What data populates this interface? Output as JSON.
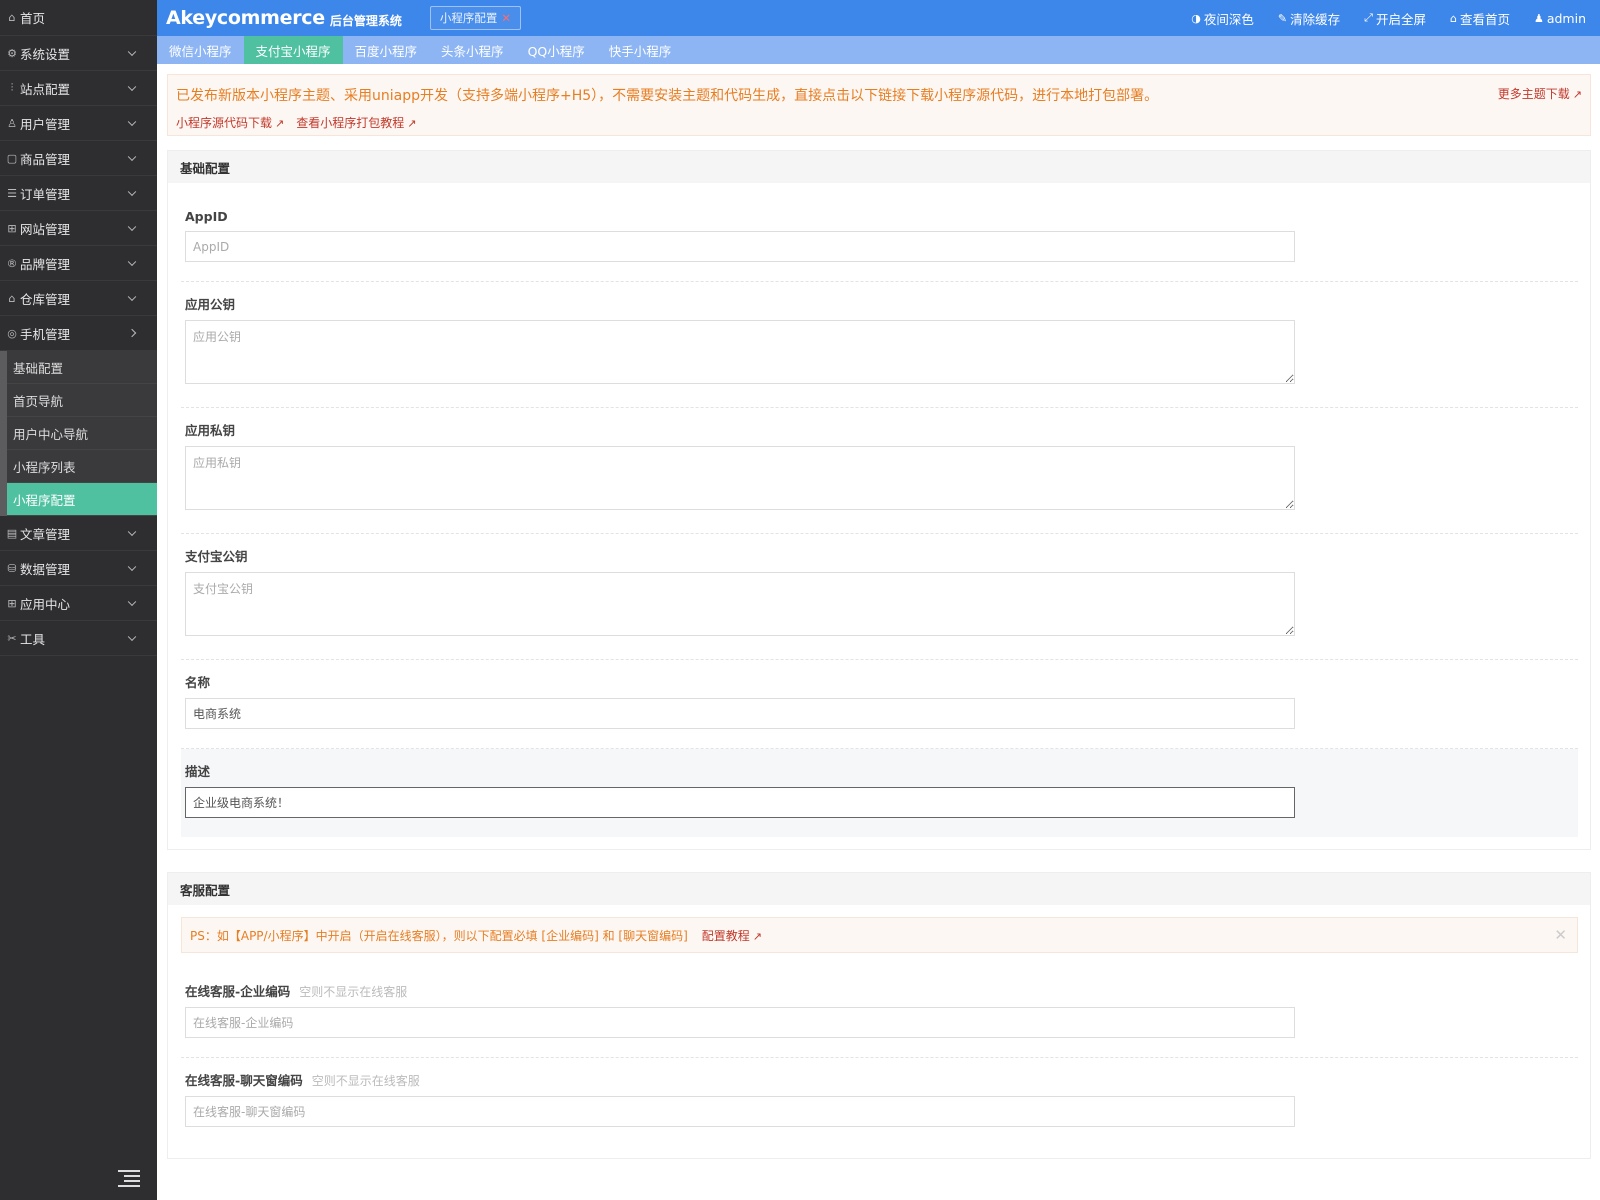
{
  "header": {
    "brand": "Akeycommerce",
    "brand_sub": "后台管理系统",
    "open_tab": "小程序配置",
    "actions": [
      {
        "icon": "contrast-icon",
        "glyph": "◑",
        "label": "夜间深色"
      },
      {
        "icon": "brush-icon",
        "glyph": "✎",
        "label": "清除缓存"
      },
      {
        "icon": "fullscreen-icon",
        "glyph": "⤢",
        "label": "开启全屏"
      },
      {
        "icon": "home-icon",
        "glyph": "⌂",
        "label": "查看首页"
      },
      {
        "icon": "user-icon",
        "glyph": "♟",
        "label": "admin"
      }
    ]
  },
  "sidebar": {
    "home": {
      "icon": "home-icon",
      "glyph": "⌂",
      "label": "首页"
    },
    "menu_top": [
      {
        "key": "system",
        "icon": "gear-icon",
        "glyph": "⚙",
        "label": "系统设置"
      },
      {
        "key": "site",
        "icon": "sliders-icon",
        "glyph": "⫶",
        "label": "站点配置"
      },
      {
        "key": "user",
        "icon": "user-icon",
        "glyph": "♙",
        "label": "用户管理"
      },
      {
        "key": "goods",
        "icon": "box-icon",
        "glyph": "▢",
        "label": "商品管理"
      },
      {
        "key": "order",
        "icon": "list-icon",
        "glyph": "☰",
        "label": "订单管理"
      },
      {
        "key": "web",
        "icon": "website-icon",
        "glyph": "⊞",
        "label": "网站管理"
      },
      {
        "key": "brand",
        "icon": "registered-icon",
        "glyph": "®",
        "label": "品牌管理"
      },
      {
        "key": "warehouse",
        "icon": "warehouse-icon",
        "glyph": "⌂",
        "label": "仓库管理"
      },
      {
        "key": "mobile",
        "icon": "mobile-icon",
        "glyph": "◎",
        "label": "手机管理"
      }
    ],
    "sub_items": [
      "基础配置",
      "首页导航",
      "用户中心导航",
      "小程序列表",
      "小程序配置"
    ],
    "menu_bottom": [
      {
        "key": "article",
        "icon": "article-icon",
        "glyph": "▤",
        "label": "文章管理"
      },
      {
        "key": "data",
        "icon": "database-icon",
        "glyph": "⛁",
        "label": "数据管理"
      },
      {
        "key": "apps",
        "icon": "apps-icon",
        "glyph": "⊞",
        "label": "应用中心"
      },
      {
        "key": "tools",
        "icon": "tools-icon",
        "glyph": "✂",
        "label": "工具"
      }
    ]
  },
  "subtabs": [
    "微信小程序",
    "支付宝小程序",
    "百度小程序",
    "头条小程序",
    "QQ小程序",
    "快手小程序"
  ],
  "notice": {
    "message": "已发布新版本小程序主题、采用uniapp开发（支持多端小程序+H5），不需要安装主题和代码生成，直接点击以下链接下载小程序源代码，进行本地打包部署。",
    "link_download": "小程序源代码下载",
    "link_tutorial": "查看小程序打包教程",
    "more": "更多主题下载"
  },
  "basic": {
    "title": "基础配置",
    "appid": {
      "label": "AppID",
      "placeholder": "AppID",
      "value": ""
    },
    "public_key": {
      "label": "应用公钥",
      "placeholder": "应用公钥"
    },
    "private_key": {
      "label": "应用私钥",
      "placeholder": "应用私钥"
    },
    "alipay_key": {
      "label": "支付宝公钥",
      "placeholder": "支付宝公钥"
    },
    "name": {
      "label": "名称",
      "value": "电商系统"
    },
    "desc": {
      "label": "描述",
      "value": "企业级电商系统！"
    }
  },
  "service": {
    "title": "客服配置",
    "ps": "PS：如【APP/小程序】中开启（开启在线客服），则以下配置必填 [企业编码] 和 [聊天窗编码]",
    "ps_link": "配置教程",
    "corp_code": {
      "label": "在线客服-企业编码",
      "hint": "空则不显示在线客服",
      "placeholder": "在线客服-企业编码"
    },
    "chat_code": {
      "label": "在线客服-聊天窗编码",
      "hint": "空则不显示在线客服",
      "placeholder": "在线客服-聊天窗编码"
    }
  }
}
